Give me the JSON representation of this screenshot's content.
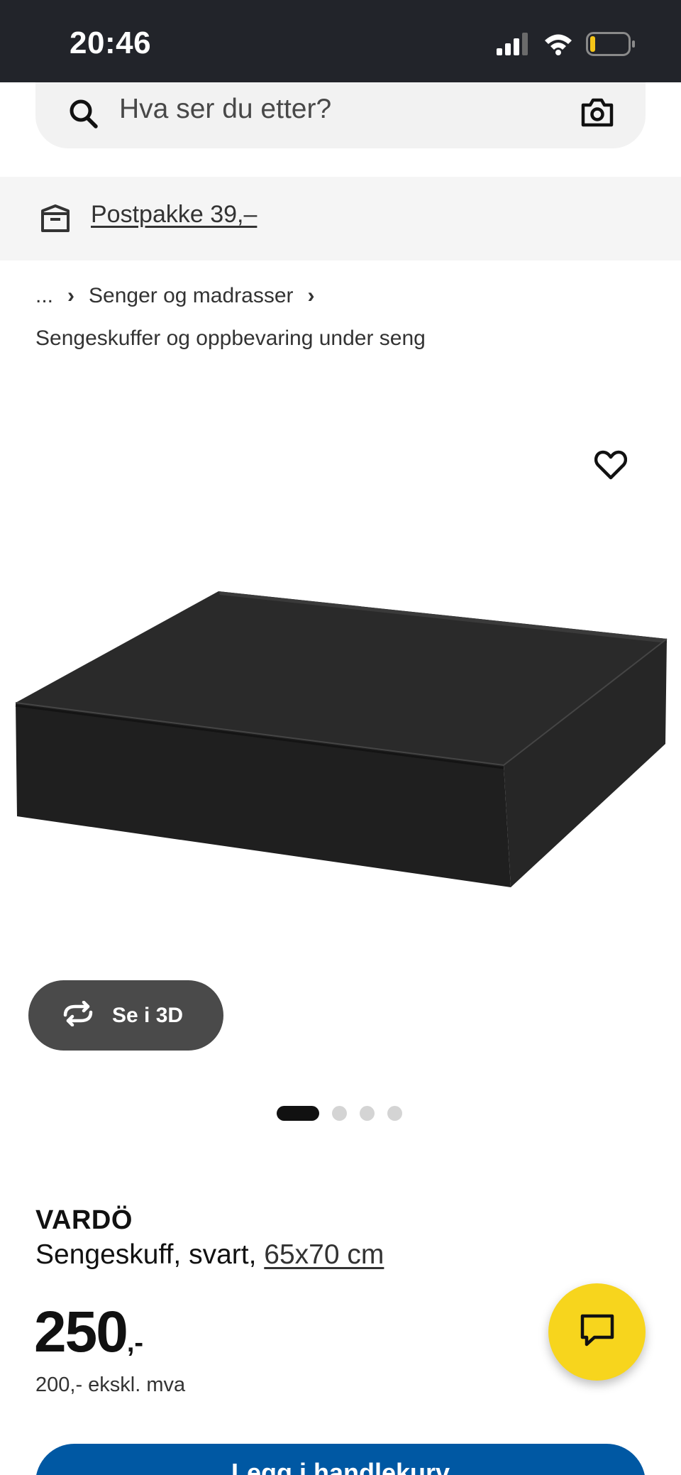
{
  "status_bar": {
    "time": "20:46",
    "icons": [
      "signal-icon",
      "wifi-icon",
      "battery-icon"
    ]
  },
  "search": {
    "placeholder": "Hva ser du etter?",
    "icons": [
      "search-icon",
      "camera-icon"
    ]
  },
  "promo": {
    "text": "Postpakke 39,–",
    "icon": "package-icon"
  },
  "breadcrumb": {
    "ellipsis": "...",
    "level": "Senger og madrasser",
    "current": "Sengeskuffer og oppbevaring under seng"
  },
  "gallery": {
    "view_3d_label": "Se i 3D",
    "image_count": 4,
    "active_index": 0
  },
  "product": {
    "brand": "VARDÖ",
    "description": "Sengeskuff, svart,",
    "size": "65x70 cm",
    "price": "250",
    "price_suffix": ",-",
    "price_ex_vat": "200,- ekskl. mva"
  },
  "actions": {
    "add_to_cart": "Legg i handlekurv"
  },
  "colors": {
    "status_bar": "#22242a",
    "chat_button": "#f7d51d",
    "cart_button": "#0058a3",
    "battery_level": "#f5c518"
  }
}
